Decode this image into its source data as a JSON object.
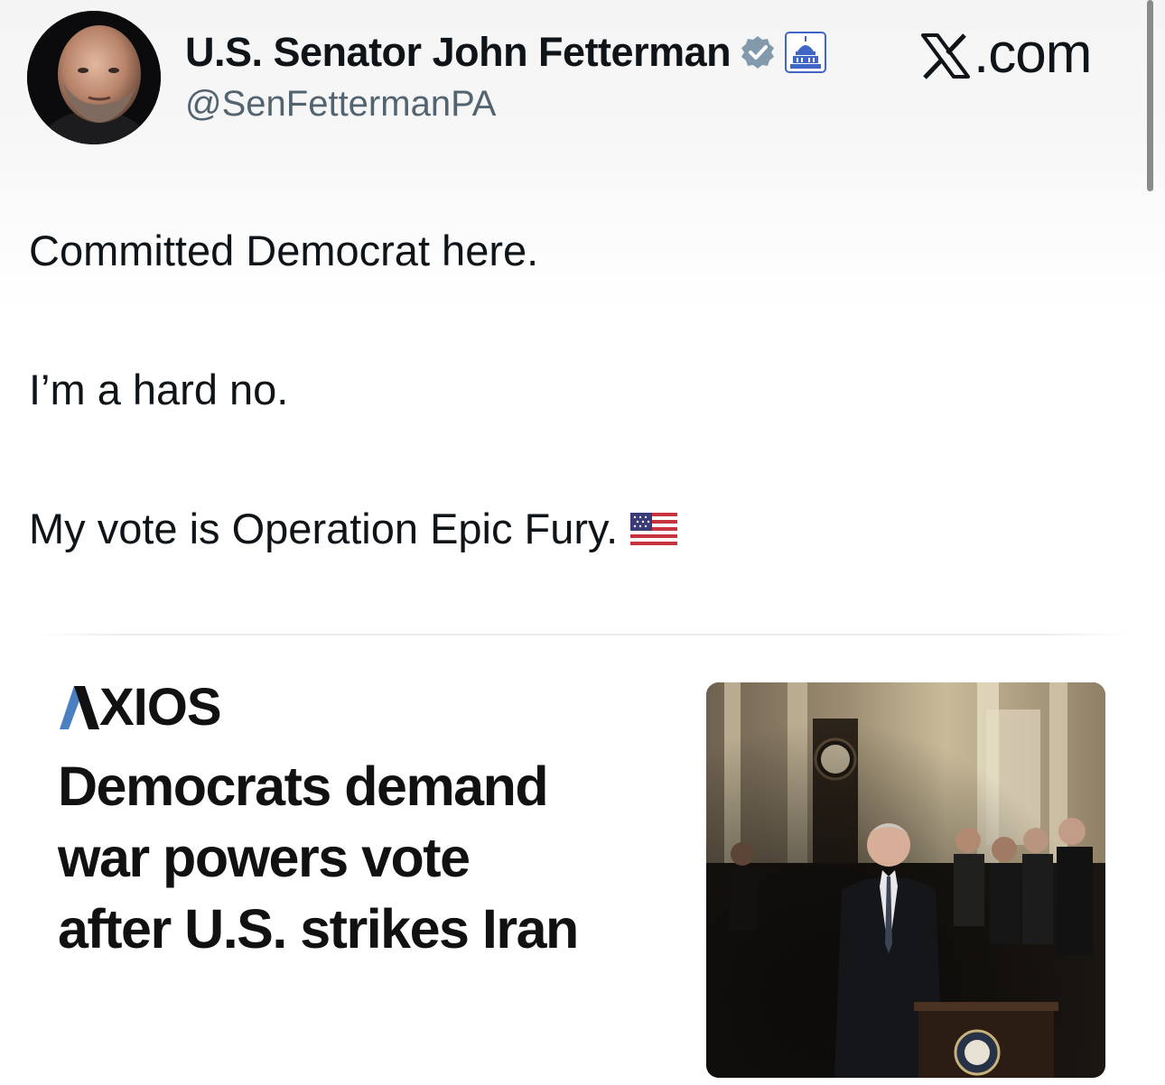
{
  "post": {
    "display_name": "U.S. Senator John Fetterman",
    "handle": "@SenFettermanPA",
    "site_label": ".com",
    "lines": [
      "Committed Democrat here.",
      "I’m a hard no.",
      "My vote is Operation Epic Fury."
    ],
    "icons": {
      "avatar": "profile-photo",
      "verified": "verified-badge-icon",
      "affiliate": "capitol-icon",
      "site": "x-logo-icon",
      "flag": "us-flag-icon"
    }
  },
  "card": {
    "publisher": "XIOS",
    "headline_lines": [
      "Democrats demand",
      "war powers vote",
      "after U.S. strikes Iran"
    ],
    "image": "press-conference-photo"
  },
  "colors": {
    "text": "#0f1419",
    "secondary_text": "#536471",
    "badge_gray": "#829aab",
    "capitol_blue": "#3f66c6"
  }
}
